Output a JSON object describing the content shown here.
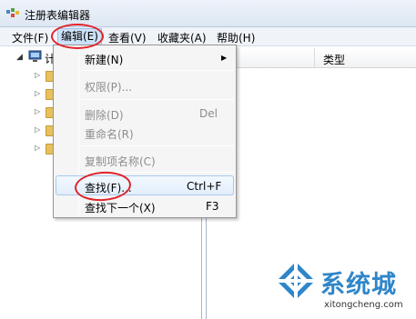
{
  "window": {
    "title": "注册表编辑器"
  },
  "menubar": {
    "items": [
      {
        "label": "文件(F)"
      },
      {
        "label": "编辑(E)"
      },
      {
        "label": "查看(V)"
      },
      {
        "label": "收藏夹(A)"
      },
      {
        "label": "帮助(H)"
      }
    ]
  },
  "tree": {
    "root_label": "计"
  },
  "list_header": {
    "type_label": "类型"
  },
  "context_menu": {
    "items": [
      {
        "label": "新建(N)",
        "shortcut": "",
        "enabled": true
      },
      {
        "label": "权限(P)...",
        "shortcut": "",
        "enabled": false
      },
      {
        "label": "删除(D)",
        "shortcut": "Del",
        "enabled": false
      },
      {
        "label": "重命名(R)",
        "shortcut": "",
        "enabled": false
      },
      {
        "label": "复制项名称(C)",
        "shortcut": "",
        "enabled": false
      },
      {
        "label": "查找(F)...",
        "shortcut": "Ctrl+F",
        "enabled": true
      },
      {
        "label": "查找下一个(X)",
        "shortcut": "F3",
        "enabled": true
      }
    ]
  },
  "watermark": {
    "brand": "系统城",
    "url": "xitongcheng.com"
  },
  "colors": {
    "annotation": "#e0232a",
    "brand_blue": "#2f86c9"
  }
}
